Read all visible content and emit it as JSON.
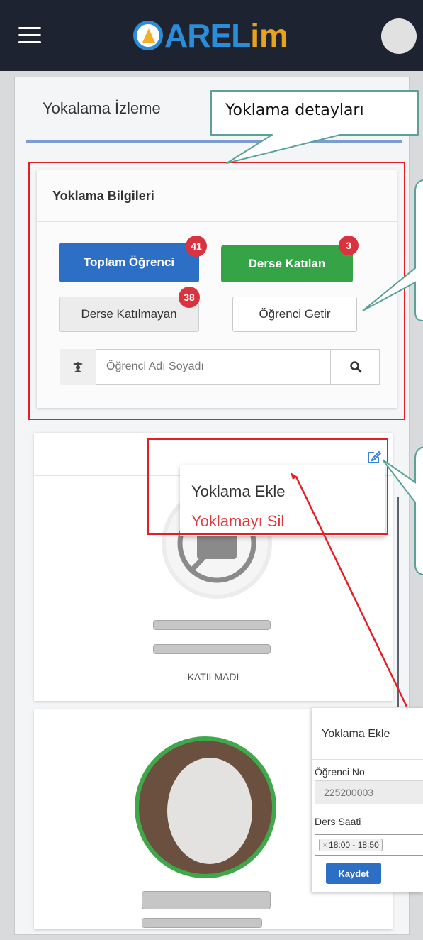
{
  "header": {
    "logo_text_a": "AREL",
    "logo_text_b": "im"
  },
  "page": {
    "title": "Yokalama İzleme"
  },
  "info_card": {
    "title": "Yoklama Bilgileri",
    "total_label": "Toplam Öğrenci",
    "total_count": "41",
    "attended_label": "Derse Katılan",
    "attended_count": "3",
    "absent_label": "Derse Katılmayan",
    "absent_count": "38",
    "fetch_label": "Öğrenci Getir",
    "search_placeholder": "Öğrenci Adı Soyadı"
  },
  "student_card": {
    "status": "KATILMADI"
  },
  "dropdown": {
    "add": "Yoklama Ekle",
    "delete": "Yoklamayı Sil"
  },
  "modal": {
    "title": "Yoklama Ekle",
    "student_no_label": "Öğrenci No",
    "student_no_value": "225200003",
    "lesson_hour_label": "Ders Saati",
    "lesson_hour_tag": "18:00 - 18:50",
    "tag_remove": "×",
    "save_label": "Kaydet"
  },
  "annotations": {
    "callout_details": "Yoklama detayları"
  },
  "colors": {
    "topbar": "#1d2330",
    "primary": "#2e6fc6",
    "success": "#34a447",
    "badge": "#d9333f",
    "annotation_red": "#e51e25",
    "callout_border": "#5aa197"
  }
}
